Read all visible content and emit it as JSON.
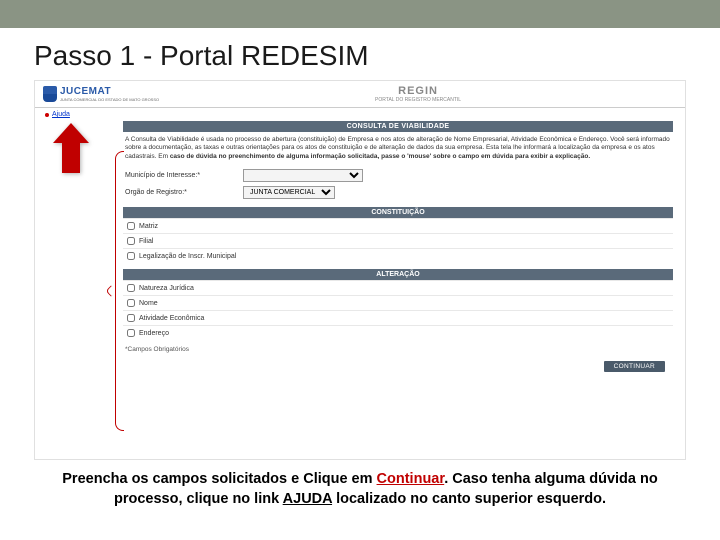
{
  "topbar": {},
  "slide": {
    "title": "Passo 1 - Portal REDESIM"
  },
  "portal": {
    "logo": {
      "name": "JUCEMAT",
      "sub": "JUNTA COMERCIAL DO ESTADO DE MATO GROSSO"
    },
    "regin": {
      "title": "REGIN",
      "sub": "PORTAL DO REGISTRO MERCANTIL"
    },
    "ajuda": "Ajuda",
    "band_consulta": "CONSULTA DE VIABILIDADE",
    "desc_html": "A Consulta de Viabilidade é usada no processo de abertura (constituição) de Empresa e nos atos de alteração de Nome Empresarial, Atividade Econômica e Endereço. Você será informado sobre a documentação, as taxas e outras orientações para os atos de constituição e de alteração de dados da sua empresa. Esta tela lhe informará a localização da empresa e os atos cadastrais. Em",
    "desc_bold": "caso de dúvida no preenchimento de alguma informação solicitada, passe o 'mouse' sobre o campo em dúvida para exibir a explicação.",
    "form": {
      "municipio_label": "Município de Interesse:*",
      "municipio_placeholder": "",
      "orgao_label": "Orgão de Registro:*",
      "orgao_value": "JUNTA COMERCIAL"
    },
    "section_const": "CONSTITUIÇÃO",
    "opts_const": [
      "Matriz",
      "Filial",
      "Legalização de Inscr. Municipal"
    ],
    "section_alt": "ALTERAÇÃO",
    "opts_alt": [
      "Natureza Jurídica",
      "Nome",
      "Atividade Econômica",
      "Endereço"
    ],
    "req_note": "*Campos Obrigatórios",
    "continue": "CONTINUAR"
  },
  "caption": {
    "p1": "Preencha os campos solicitados e Clique em ",
    "continuar": "Continuar",
    "p2": ". Caso tenha alguma dúvida no processo, clique no link ",
    "ajuda": "AJUDA",
    "p3": " localizado no canto superior esquerdo."
  }
}
